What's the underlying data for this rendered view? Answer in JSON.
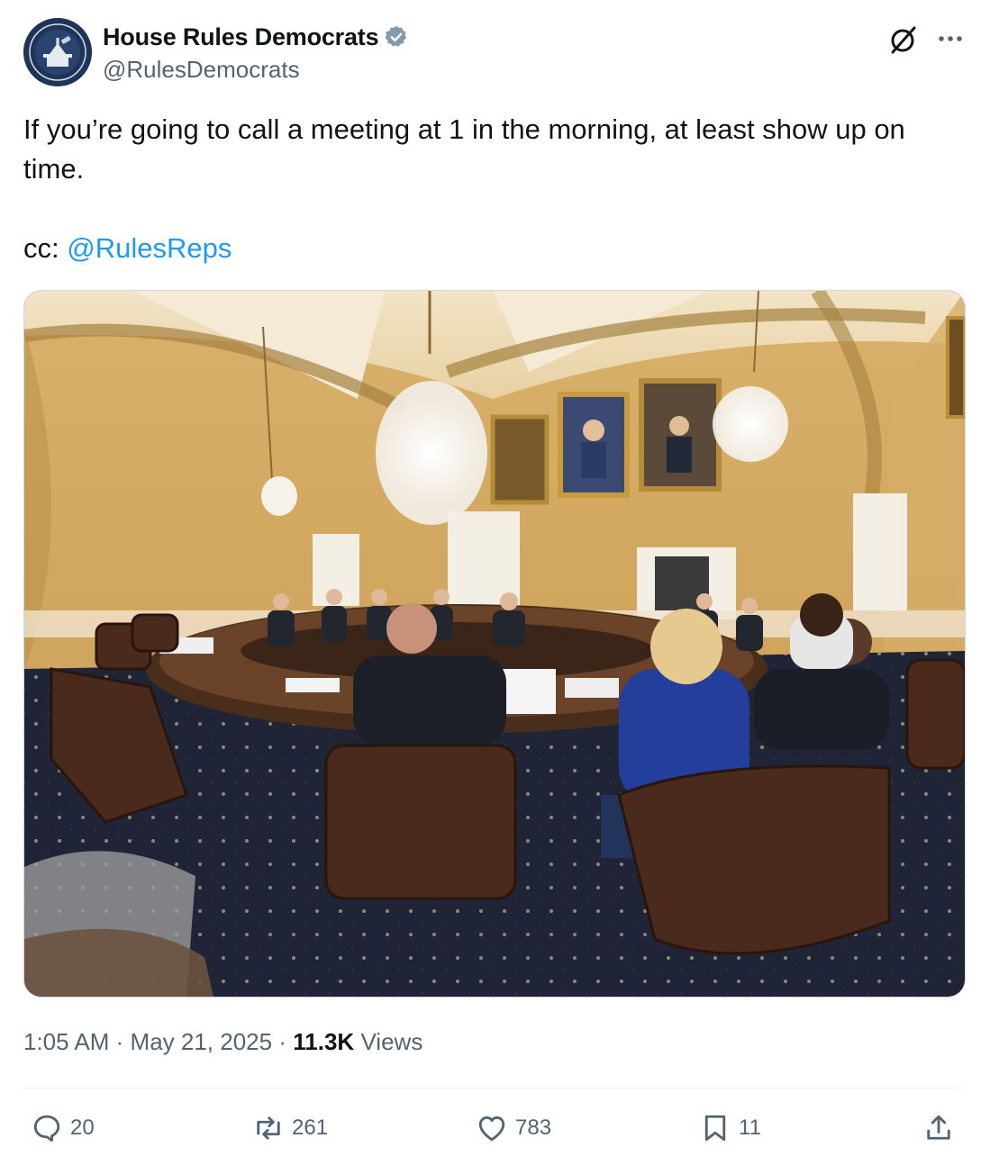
{
  "author": {
    "display_name": "House Rules Democrats",
    "handle": "@RulesDemocrats",
    "verified_badge": "verified-badge-icon",
    "avatar_icon": "capitol-seal-icon"
  },
  "tweet": {
    "text_line": "If you’re going to call a meeting at 1 in the morning, at least show up on time.",
    "cc_prefix": "cc:",
    "mention": "@RulesReps",
    "media_icon": "committee-room-photo"
  },
  "meta": {
    "time": "1:05 AM",
    "sep1": "·",
    "date": "May 21, 2025",
    "sep2": "·",
    "views_count": "11.3K",
    "views_label": "Views"
  },
  "actions": {
    "replies": "20",
    "reposts": "261",
    "likes": "783",
    "bookmarks": "11"
  },
  "colors": {
    "link": "#1d9bf0",
    "secondary_text": "#536471",
    "primary_text": "#0f1419"
  }
}
